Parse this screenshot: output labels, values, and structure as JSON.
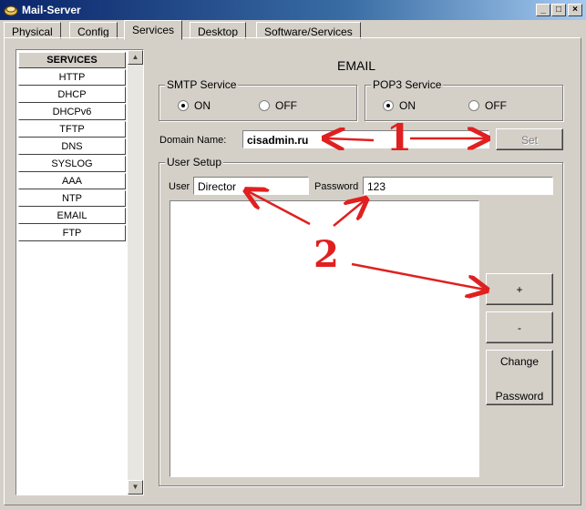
{
  "window": {
    "title": "Mail-Server"
  },
  "tabs": [
    "Physical",
    "Config",
    "Services",
    "Desktop",
    "Software/Services"
  ],
  "active_tab": "Services",
  "services": {
    "header": "SERVICES",
    "items": [
      "HTTP",
      "DHCP",
      "DHCPv6",
      "TFTP",
      "DNS",
      "SYSLOG",
      "AAA",
      "NTP",
      "EMAIL",
      "FTP"
    ]
  },
  "email": {
    "heading": "EMAIL",
    "smtp": {
      "legend": "SMTP Service",
      "on_label": "ON",
      "off_label": "OFF",
      "selected": "ON"
    },
    "pop3": {
      "legend": "POP3 Service",
      "on_label": "ON",
      "off_label": "OFF",
      "selected": "ON"
    },
    "domain": {
      "label": "Domain Name:",
      "value": "cisadmin.ru",
      "set_label": "Set"
    },
    "user_setup": {
      "legend": "User Setup",
      "user_label": "User",
      "user_value": "Director",
      "password_label": "Password",
      "password_value": "123",
      "add_label": "+",
      "remove_label": "-",
      "change_label_1": "Change",
      "change_label_2": "Password"
    }
  },
  "annotations": {
    "marker_1": "1",
    "marker_2": "2",
    "color": "#e02020"
  }
}
